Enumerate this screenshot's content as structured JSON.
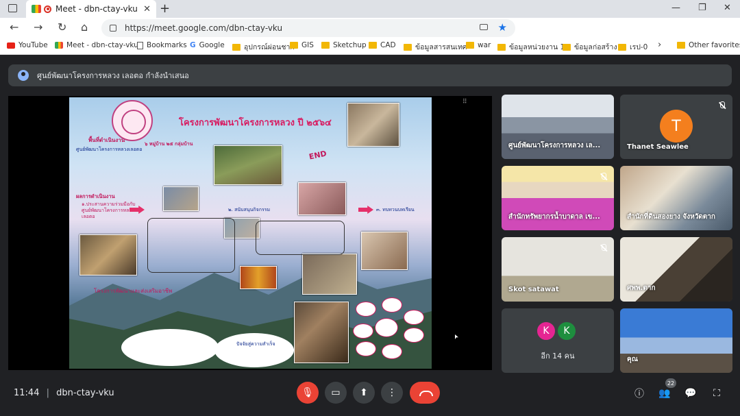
{
  "browser": {
    "tab_title": "Meet - dbn-ctay-vku",
    "url": "https://meet.google.com/dbn-ctay-vku",
    "bookmarks": [
      {
        "label": "YouTube",
        "icon": "youtube-icon"
      },
      {
        "label": "Meet - dbn-ctay-vku",
        "icon": "meet-icon"
      },
      {
        "label": "Bookmarks",
        "icon": "page-icon"
      },
      {
        "label": "Google",
        "icon": "google-icon"
      },
      {
        "label": "อุปกรณ์ผ่อนชาก",
        "icon": "folder-icon"
      },
      {
        "label": "GIS",
        "icon": "folder-icon"
      },
      {
        "label": "Sketchup",
        "icon": "folder-icon"
      },
      {
        "label": "CAD",
        "icon": "folder-icon"
      },
      {
        "label": "ข้อมูลสารสนเทศ",
        "icon": "folder-icon"
      },
      {
        "label": "war",
        "icon": "folder-icon"
      },
      {
        "label": "ข้อมูลหน่วยงาน 1",
        "icon": "folder-icon"
      },
      {
        "label": "ข้อมูลก่อสร้าง",
        "icon": "folder-icon"
      },
      {
        "label": "เรป-0",
        "icon": "folder-icon"
      }
    ],
    "other_favorites": "Other favorites"
  },
  "meet": {
    "presenter_banner": "ศูนย์พัฒนาโครงการหลวง เลอตอ กำลังนำเสนอ",
    "slide": {
      "title": "โครงการพัฒนาโครงการหลวง ปี ๒๕๖๔",
      "area_heading": "พื้นที่ดำเนินงาน",
      "area_sub": "ศูนย์พัฒนาโครงการหลวงเลอตอ",
      "villages": "๖ หมู่บ้าน ๒๕ กลุ่มบ้าน",
      "result_heading": "ผลการดำเนินงาน",
      "step1": "๑.ประสานความร่วมมือกับศูนย์พัฒนาโครงการหลวงเลอตอ",
      "step2": "๒. สนับสนุนกิจกรรม",
      "step3": "๓. ทบทวนบทเรียน",
      "bottom_left": "โครงการพัฒนาและส่งเสริมอาชีพ",
      "bottom_mid": "ปัจจัยสู่ความสำเร็จ",
      "end_tag": "END"
    },
    "participants": [
      {
        "name": "ศูนย์พัฒนาโครงการหลวง เล...",
        "muted": false
      },
      {
        "name": "Thanet Seawlee",
        "muted": true,
        "initial": "T"
      },
      {
        "name": "สำนักทรัพยากรน้ำบาดาล เข...",
        "muted": true
      },
      {
        "name": "สำนักที่ดินสองยาง จังหวัดตาก",
        "muted": false
      },
      {
        "name": "Skot satawat",
        "muted": true
      },
      {
        "name": "ศพพ.ตาก",
        "muted": false
      },
      {
        "name": "อีก 14 คน",
        "initials": [
          "K",
          "K"
        ]
      },
      {
        "name": "คุณ",
        "muted": false
      }
    ],
    "time": "11:44",
    "meeting_code": "dbn-ctay-vku",
    "participant_count": "22"
  }
}
